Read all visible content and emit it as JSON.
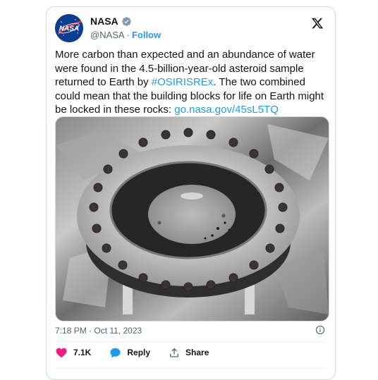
{
  "tweet": {
    "author_name": "NASA",
    "handle": "@NASA",
    "separator": "·",
    "follow_label": "Follow",
    "text_before_hashtag": "More carbon than expected and an abundance of water were found in the 4.5-billion-year-old asteroid sample returned to Earth by ",
    "hashtag": "#OSIRISREx",
    "text_after_hashtag": ". The two combined could mean that the building blocks for life on Earth might be locked in these rocks: ",
    "link": "go.nasa.gov/45sL5TQ",
    "timestamp": "7:18 PM · Oct 11, 2023",
    "avatar_text": "NASA"
  },
  "actions": {
    "like_count": "7.1K",
    "reply_label": "Reply",
    "share_label": "Share"
  },
  "icons": {
    "verified": "verified-badge-icon",
    "x_logo": "x-logo-icon",
    "info": "info-icon",
    "like": "heart-icon",
    "reply": "reply-bubble-icon",
    "share": "share-upload-icon"
  },
  "colors": {
    "accent": "#1d9bf0",
    "like": "#f91880",
    "text": "#0f1419",
    "muted": "#536471"
  }
}
